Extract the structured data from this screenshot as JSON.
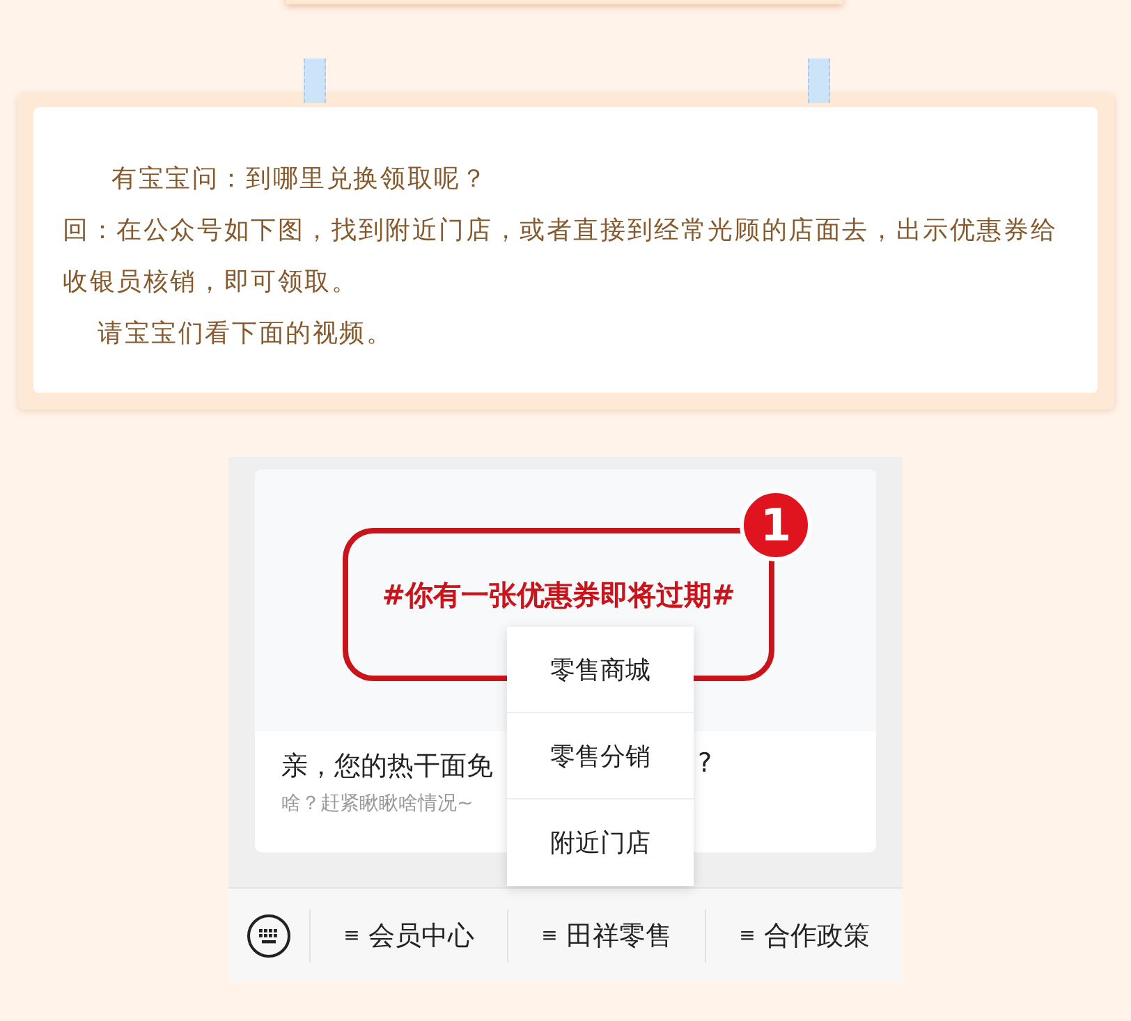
{
  "article": {
    "paragraphs": [
      {
        "kind": "question",
        "text": "有宝宝问：到哪里兑换领取呢？"
      },
      {
        "kind": "answer",
        "text": "回：在公众号如下图，找到附近门店，或者直接到经常光顾的店面去，出示优惠券给收银员核销，即可领取。"
      },
      {
        "kind": "note",
        "text": "请宝宝们看下面的视频。"
      }
    ]
  },
  "embedded_screen": {
    "banner": {
      "text": "#你有一张优惠券即将过期#",
      "badge": "1"
    },
    "card_title": "亲，您的热干面免",
    "card_title_end": "?",
    "card_subtitle": "啥？赶紧瞅瞅啥情况~",
    "popup_menu": [
      "零售商城",
      "零售分销",
      "附近门店"
    ],
    "bottom_menu": [
      {
        "icon": "≡",
        "label": "会员中心"
      },
      {
        "icon": "≡",
        "label": "田祥零售"
      },
      {
        "icon": "≡",
        "label": "合作政策"
      }
    ]
  }
}
